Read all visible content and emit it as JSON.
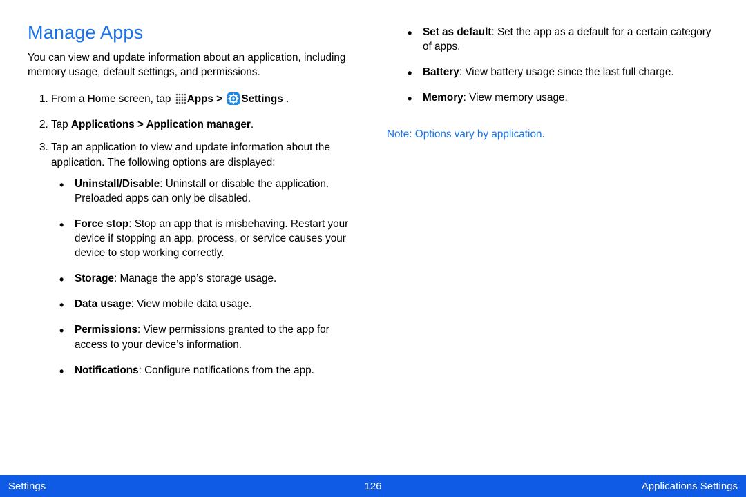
{
  "section_title": "Manage Apps",
  "intro": "You can view and update information about an application, including memory usage, default settings, and permissions.",
  "step1": {
    "prefix": "From a Home screen, tap ",
    "apps_label": "Apps > ",
    "settings_label": "Settings",
    "suffix": " ."
  },
  "step2": {
    "prefix": "Tap ",
    "bold": "Applications > Application manager",
    "suffix": "."
  },
  "step3": {
    "text": "Tap an application to view and update information about the application. The following options are displayed:"
  },
  "bullets_left": [
    {
      "term": "Uninstall/Disable",
      "desc": ": Uninstall or disable the application. Preloaded apps can only be disabled."
    },
    {
      "term": "Force stop",
      "desc": ": Stop an app that is misbehaving. Restart your device if stopping an app, process, or service causes your device to stop working correctly."
    },
    {
      "term": "Storage",
      "desc": ": Manage the app’s storage usage."
    },
    {
      "term": "Data usage",
      "desc": ": View mobile data usage."
    },
    {
      "term": "Permissions",
      "desc": ": View permissions granted to the app for access to your device’s information."
    },
    {
      "term": "Notifications",
      "desc": ": Configure notifications from the app."
    }
  ],
  "bullets_right": [
    {
      "term": "Set as default",
      "desc": ": Set the app as a default for a certain category of apps."
    },
    {
      "term": "Battery",
      "desc": ": View battery usage since the last full charge."
    },
    {
      "term": "Memory",
      "desc": ": View memory usage."
    }
  ],
  "note": {
    "label": "Note",
    "text": ": Options vary by application."
  },
  "footer": {
    "left": "Settings",
    "page": "126",
    "right": "Applications Settings"
  }
}
